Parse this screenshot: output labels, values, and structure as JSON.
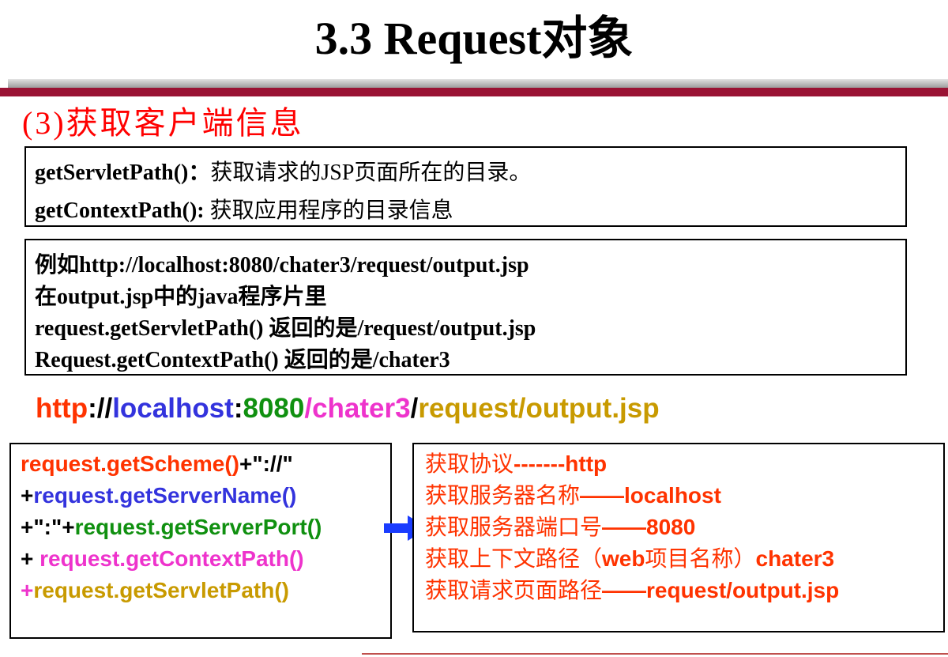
{
  "title": "3.3  Request对象",
  "subtitle": "(3)获取客户端信息",
  "definitions": [
    {
      "method": "getServletPath()",
      "sep": "：",
      "desc": "获取请求的JSP页面所在的目录。"
    },
    {
      "method": "getContextPath():",
      "sep": " ",
      "desc": "获取应用程序的目录信息"
    }
  ],
  "example_lines": [
    "例如http://localhost:8080/chater3/request/output.jsp",
    "在output.jsp中的java程序片里",
    "request.getServletPath()  返回的是/request/output.jsp",
    "Request.getContextPath()  返回的是/chater3"
  ],
  "url_parts": {
    "scheme": "http",
    "sep1": "://",
    "host": "localhost",
    "sep2": ":",
    "port": "8080",
    "context": "/chater3",
    "sep3": "/",
    "path": "request/output.jsp"
  },
  "code": {
    "l1_a": "request.getScheme()",
    "l1_b": "+\"://\"",
    "l2_a": "+",
    "l2_b": "request.getServerName()",
    "l3_a": "+\":\"+",
    "l3_b": "request.getServerPort()",
    "l4_a": "+ ",
    "l4_b": "request.getContextPath()",
    "l5_a": "+",
    "l5_b": "request.getServletPath()"
  },
  "results": [
    {
      "cn": "获取协议",
      "en": "-------http"
    },
    {
      "cn": "获取服务器名称",
      "en": "——localhost"
    },
    {
      "cn": "获取服务器端口号",
      "en": "——8080"
    },
    {
      "cn": "获取上下文路径（",
      "en": "web",
      "cn2": "项目名称）",
      "en2": "chater3"
    },
    {
      "cn": "获取请求页面路径",
      "en": "——request/output.jsp"
    }
  ],
  "colors": {
    "title_bar_red": "#9a1334",
    "subtitle_red": "#ff0000",
    "scheme_red": "#ff3300",
    "host_blue": "#3333dd",
    "port_green": "#109010",
    "context_pink": "#ee33cc",
    "path_gold": "#c89a00",
    "arrow_blue": "#1a3cff"
  },
  "icons": {
    "arrow": "right-arrow-icon"
  }
}
